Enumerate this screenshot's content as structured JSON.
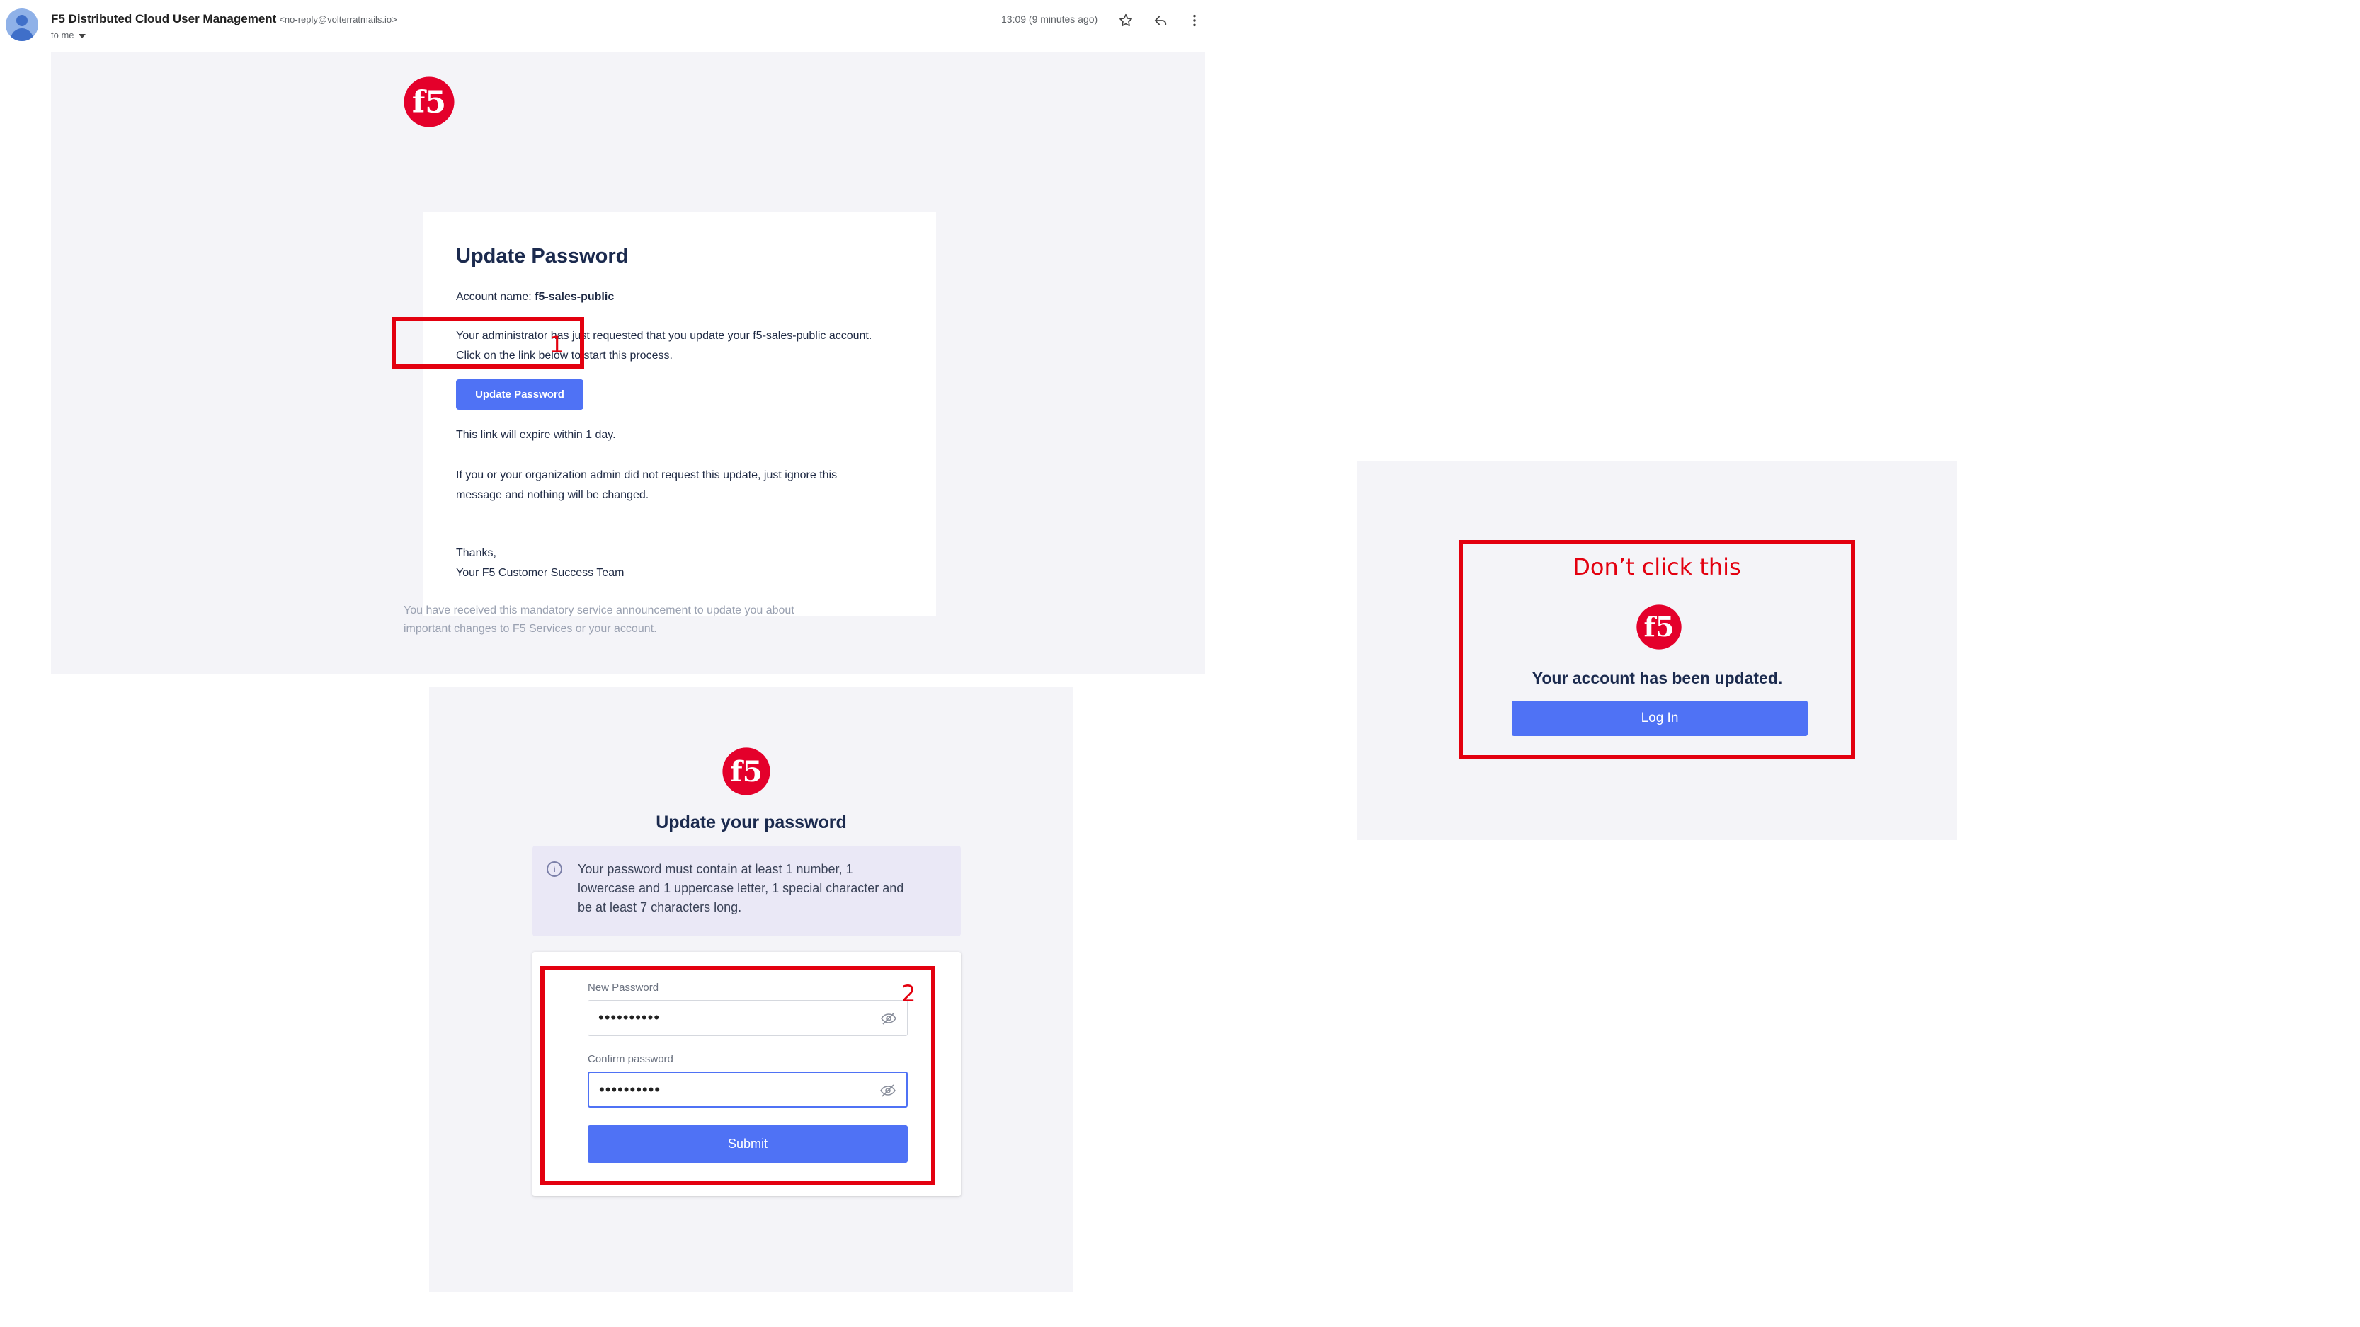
{
  "email": {
    "sender_name": "F5 Distributed Cloud User Management",
    "sender_email": "<no-reply@volterratmails.io>",
    "recipient": "to me",
    "timestamp": "13:09 (9 minutes ago)",
    "icons": [
      "star-icon",
      "reply-icon",
      "more-vert-icon"
    ],
    "card": {
      "title": "Update Password",
      "account_label": "Account name:",
      "account_name": "f5-sales-public",
      "body_line1": "Your administrator has just requested that you update your f5-sales-public account.",
      "body_line2": "Click on the link below to start this process.",
      "button_label": "Update Password",
      "expire_text": "This link will expire within 1 day.",
      "ignore_line1": "If you or your organization admin did not request this update, just ignore this",
      "ignore_line2": "message and nothing will be changed.",
      "thanks": "Thanks,",
      "signature": "Your F5 Customer Success Team"
    },
    "footer_line1": "You have received this mandatory service announcement to update you about",
    "footer_line2": "important changes to F5 Services or your account."
  },
  "update_form": {
    "title": "Update your password",
    "info_line1": "Your password must contain at least 1 number, 1",
    "info_line2": "lowercase and 1 uppercase letter, 1 special character and",
    "info_line3": "be at least 7 characters long.",
    "new_password_label": "New Password",
    "new_password_value": "••••••••••",
    "confirm_password_label": "Confirm password",
    "confirm_password_value": "••••••••••",
    "submit_label": "Submit"
  },
  "confirmation": {
    "message": "Your account has been updated.",
    "button_label": "Log In"
  },
  "annotations": {
    "step1": "1",
    "step2": "2",
    "warning": "Don’t click this"
  },
  "colors": {
    "brand_red": "#e4002b",
    "accent_blue": "#4f72f5",
    "annotation_red": "#e3000f",
    "panel_bg": "#f4f4f8"
  }
}
